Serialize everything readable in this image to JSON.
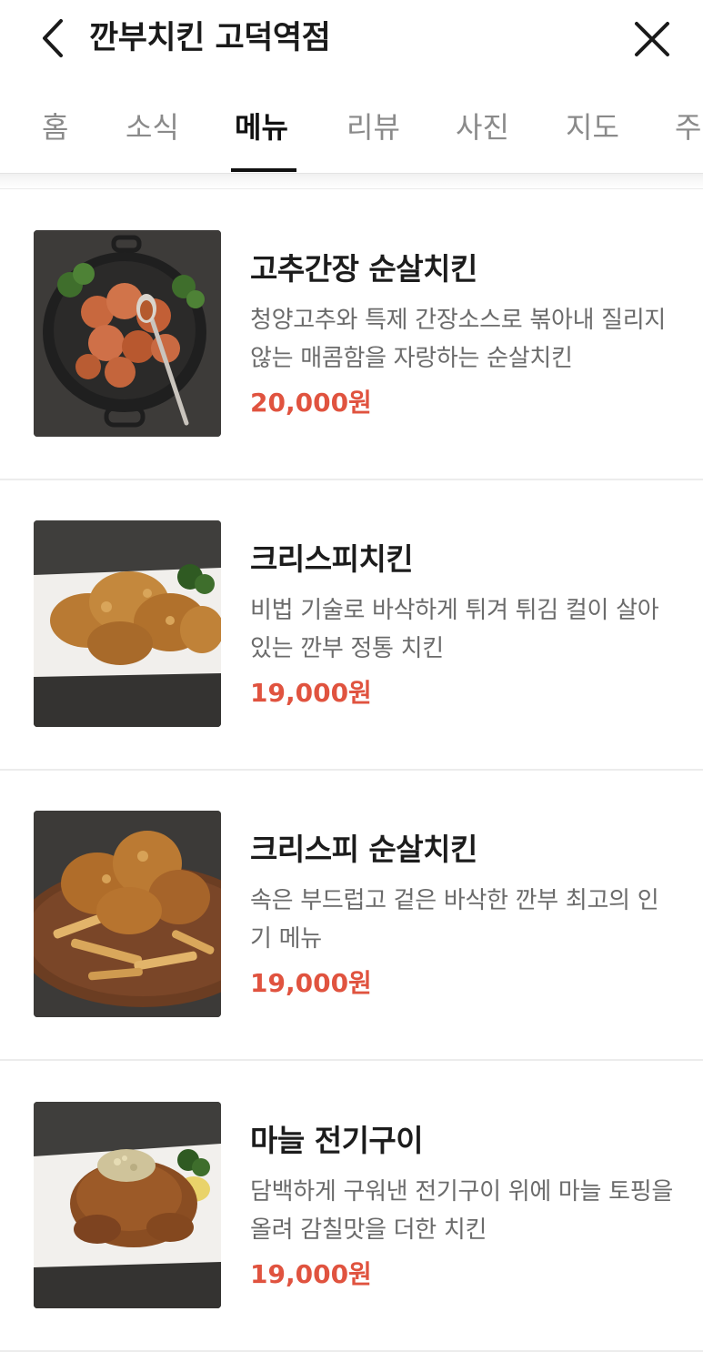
{
  "header": {
    "title": "깐부치킨 고덕역점",
    "back_icon": "chevron-left-icon",
    "close_icon": "close-icon"
  },
  "tabs": [
    {
      "label": "홈"
    },
    {
      "label": "소식"
    },
    {
      "label": "메뉴",
      "active": true
    },
    {
      "label": "리뷰"
    },
    {
      "label": "사진"
    },
    {
      "label": "지도"
    },
    {
      "label": "주"
    }
  ],
  "colors": {
    "price": "#e0533f",
    "active_tab": "#111111",
    "inactive_tab": "#8a8a8a"
  },
  "menu": {
    "items": [
      {
        "name": "고추간장 순살치킨",
        "desc": "청양고추와 특제 간장소스로 볶아내 질리지 않는 매콤함을 자랑하는 순살치킨",
        "price": "20,000원"
      },
      {
        "name": "크리스피치킨",
        "desc": "비법 기술로 바삭하게 튀겨 튀김 컬이 살아있는 깐부 정통 치킨",
        "price": "19,000원"
      },
      {
        "name": "크리스피 순살치킨",
        "desc": "속은 부드럽고 겉은 바삭한 깐부 최고의 인기 메뉴",
        "price": "19,000원"
      },
      {
        "name": "마늘 전기구이",
        "desc": "담백하게 구워낸 전기구이 위에 마늘 토핑을 올려 감칠맛을 더한 치킨",
        "price": "19,000원"
      }
    ]
  }
}
